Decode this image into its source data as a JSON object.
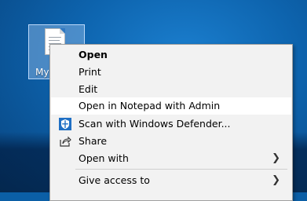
{
  "desktop": {
    "icon_label": "My",
    "icon_name": "text-document-icon"
  },
  "context_menu": {
    "items": [
      {
        "label": "Open",
        "bold": true
      },
      {
        "label": "Print"
      },
      {
        "label": "Edit"
      },
      {
        "label": "Open in Notepad with Admin",
        "highlighted": true
      },
      {
        "label": "Scan with Windows Defender...",
        "icon": "windows-defender-shield-icon"
      },
      {
        "label": "Share",
        "icon": "share-icon"
      },
      {
        "label": "Open with",
        "submenu": true
      },
      {
        "label": "Give access to",
        "submenu": true
      }
    ]
  },
  "colors": {
    "desktop_background": "#0d63ad",
    "menu_background": "#f2f2f2",
    "highlight": "#ffffff",
    "defender_blue": "#1f6fc4"
  }
}
